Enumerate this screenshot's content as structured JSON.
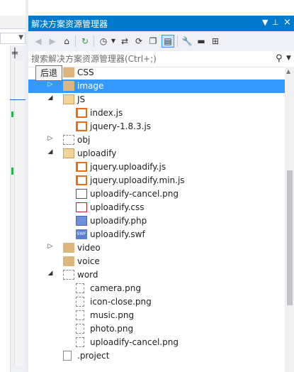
{
  "panel": {
    "title": "解决方案资源管理器",
    "pin_glyph": "↓ Й",
    "close_glyph": "×"
  },
  "search": {
    "placeholder": "搜索解决方案资源管理器(Ctrl+;)"
  },
  "tooltip": "后退",
  "colors": {
    "accent": "#007acc",
    "selection": "#3399ff",
    "folder": "#dcb67a",
    "js_icon": "#e96c1a",
    "change_marker": "#22b14c"
  },
  "tree": {
    "items": [
      {
        "label": "CSS",
        "icon": "folder-icon"
      },
      {
        "label": "image",
        "icon": "folder-icon"
      },
      {
        "label": "JS",
        "icon": "folder-open-icon"
      },
      {
        "label": "index.js",
        "icon": "js-file-icon"
      },
      {
        "label": "jquery-1.8.3.js",
        "icon": "js-file-icon"
      },
      {
        "label": "obj",
        "icon": "folder-dotted-icon"
      },
      {
        "label": "uploadify",
        "icon": "folder-open-icon"
      },
      {
        "label": "jquery.uploadify.js",
        "icon": "js-file-icon"
      },
      {
        "label": "jquery.uploadify.min.js",
        "icon": "js-file-icon"
      },
      {
        "label": "uploadify-cancel.png",
        "icon": "image-file-icon"
      },
      {
        "label": "uploadify.css",
        "icon": "css-file-icon"
      },
      {
        "label": "uploadify.php",
        "icon": "php-file-icon"
      },
      {
        "label": "uploadify.swf",
        "icon": "swf-file-icon"
      },
      {
        "label": "video",
        "icon": "folder-icon"
      },
      {
        "label": "voice",
        "icon": "folder-icon"
      },
      {
        "label": "word",
        "icon": "folder-dotted-icon"
      },
      {
        "label": "camera.png",
        "icon": "dotted-file-icon"
      },
      {
        "label": "icon-close.png",
        "icon": "dotted-file-icon"
      },
      {
        "label": "music.png",
        "icon": "dotted-file-icon"
      },
      {
        "label": "photo.png",
        "icon": "dotted-file-icon"
      },
      {
        "label": "uploadify-cancel.png",
        "icon": "dotted-file-icon"
      },
      {
        "label": ".project",
        "icon": "file-icon"
      }
    ],
    "selected": "image"
  },
  "toolbar": {
    "icons": [
      "back-icon",
      "forward-icon",
      "home-icon",
      "pending-changes-icon",
      "history-icon",
      "sync-icon",
      "refresh-icon",
      "collapse-all-icon",
      "show-all-files-icon",
      "properties-icon",
      "preview-icon",
      "class-view-icon"
    ]
  }
}
